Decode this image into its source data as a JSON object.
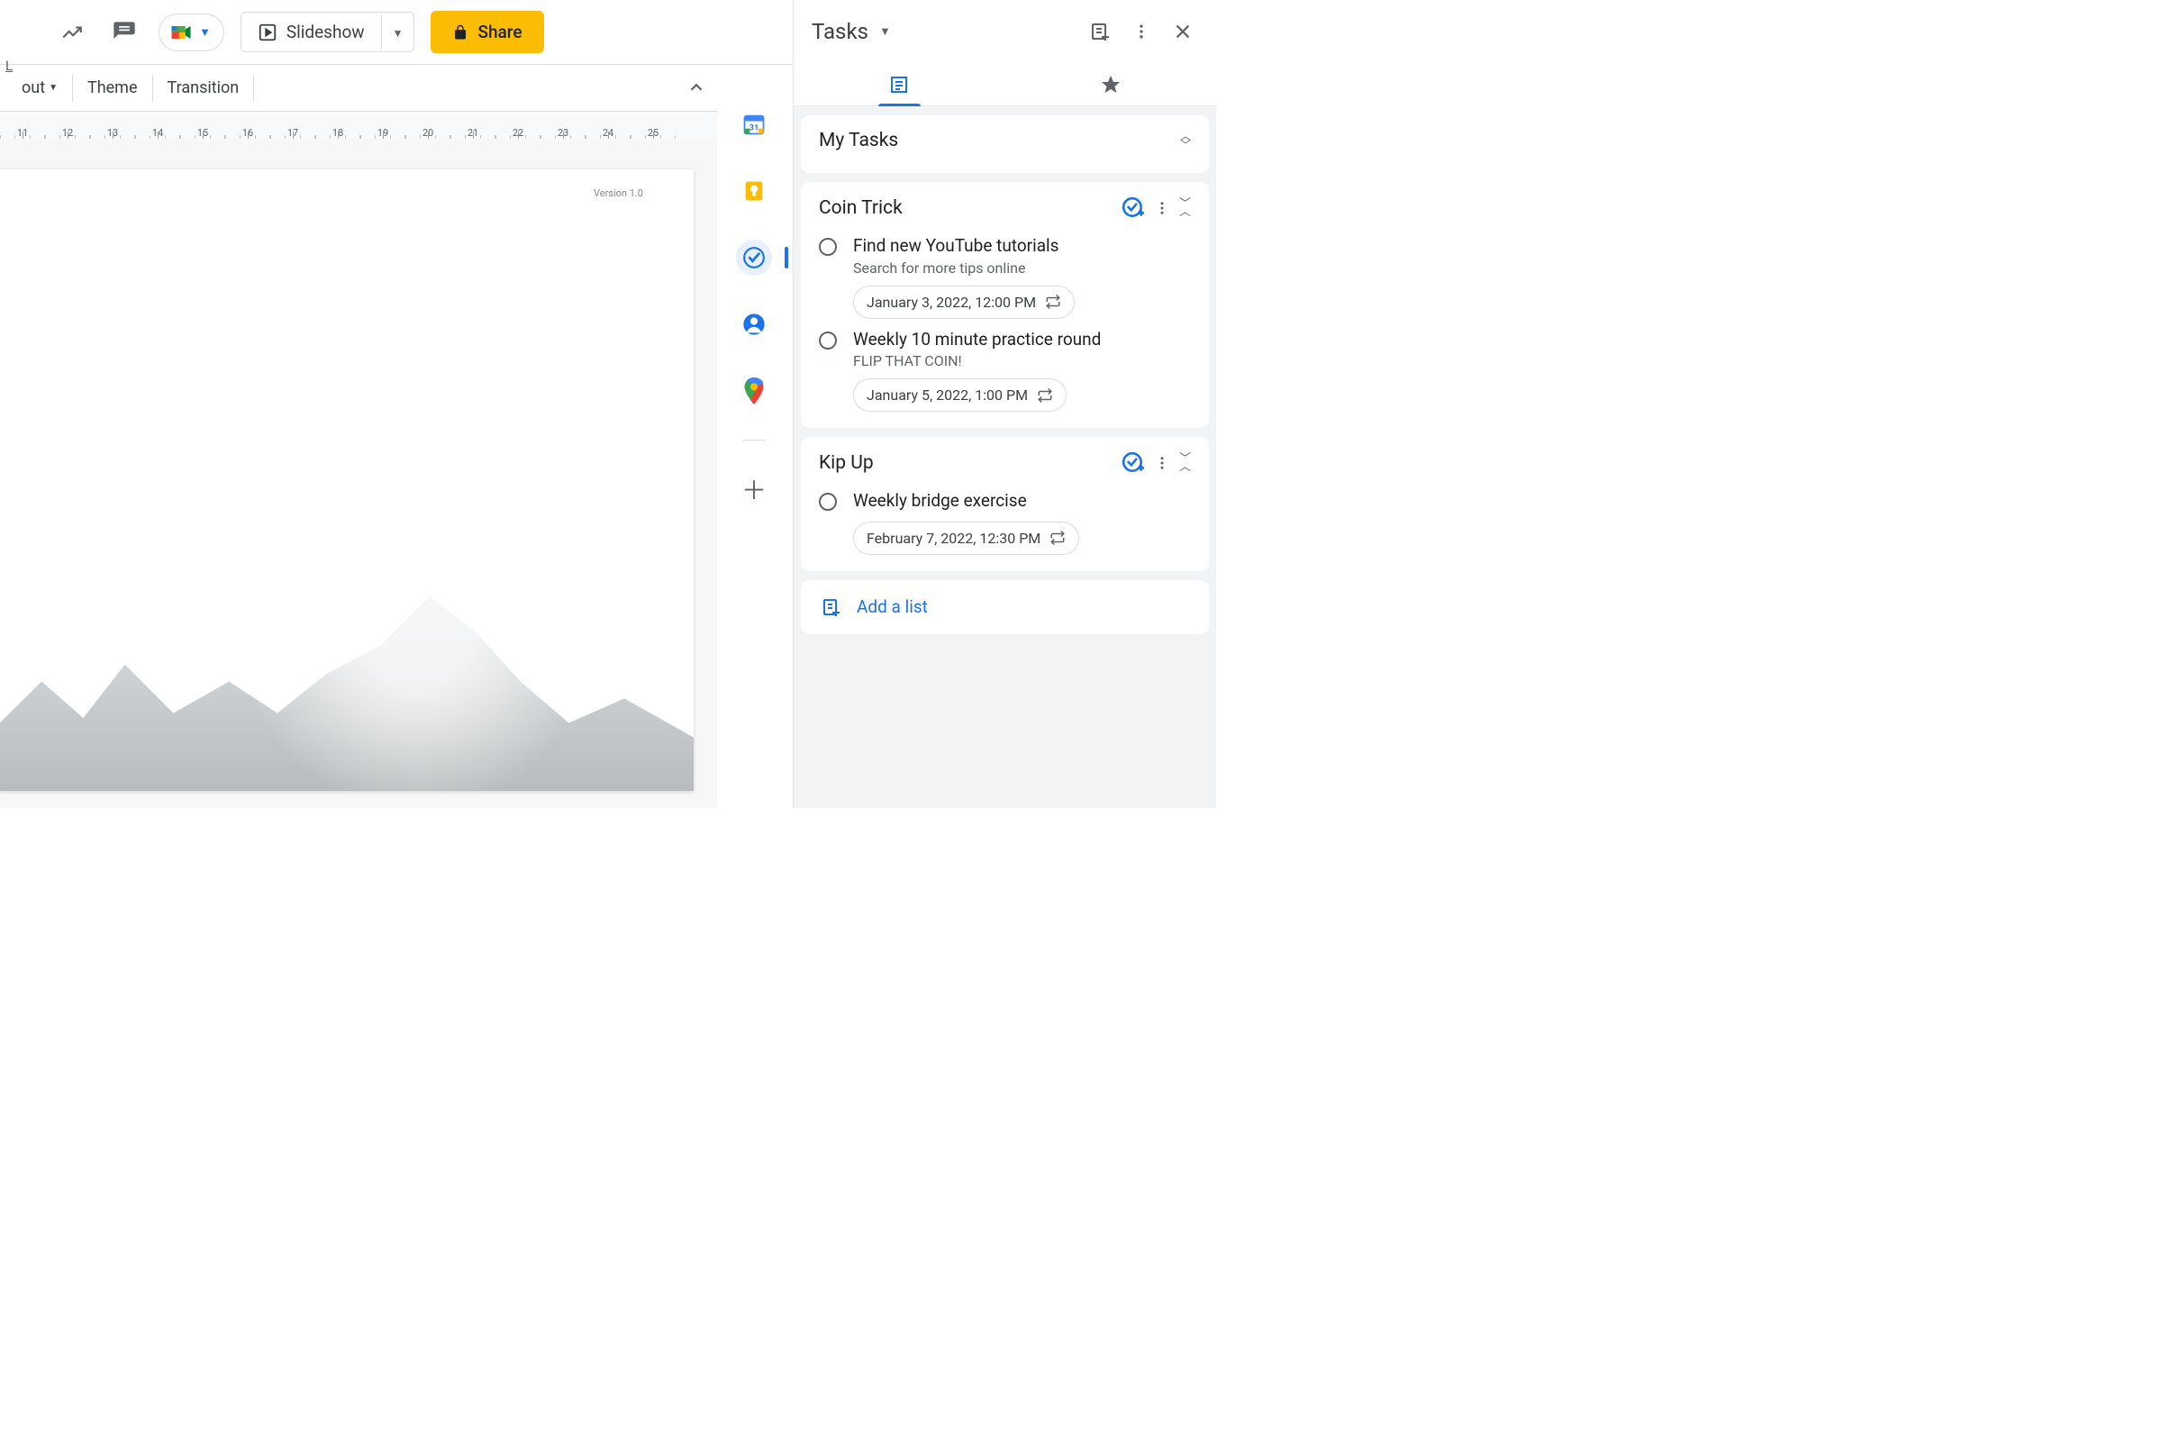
{
  "toolbar": {
    "slideshow_label": "Slideshow",
    "share_label": "Share",
    "lite_char": "L"
  },
  "menu": {
    "out_label": "out",
    "theme_label": "Theme",
    "transition_label": "Transition"
  },
  "ruler": {
    "start": 11,
    "end": 25
  },
  "slide": {
    "version_label": "Version 1.0"
  },
  "tasks": {
    "panel_title": "Tasks",
    "add_list_label": "Add a list",
    "lists": [
      {
        "name": "My Tasks",
        "collapsible_only": true,
        "tasks": []
      },
      {
        "name": "Coin Trick",
        "tasks": [
          {
            "title": "Find new YouTube tutorials",
            "subtitle": "Search for more tips online",
            "date": "January 3, 2022, 12:00 PM",
            "repeats": true
          },
          {
            "title": "Weekly 10 minute practice round",
            "subtitle": "FLIP THAT COIN!",
            "date": "January 5, 2022, 1:00 PM",
            "repeats": true
          }
        ]
      },
      {
        "name": "Kip Up",
        "tasks": [
          {
            "title": "Weekly bridge exercise",
            "subtitle": "",
            "date": "February 7, 2022, 12:30 PM",
            "repeats": true
          }
        ]
      }
    ]
  }
}
